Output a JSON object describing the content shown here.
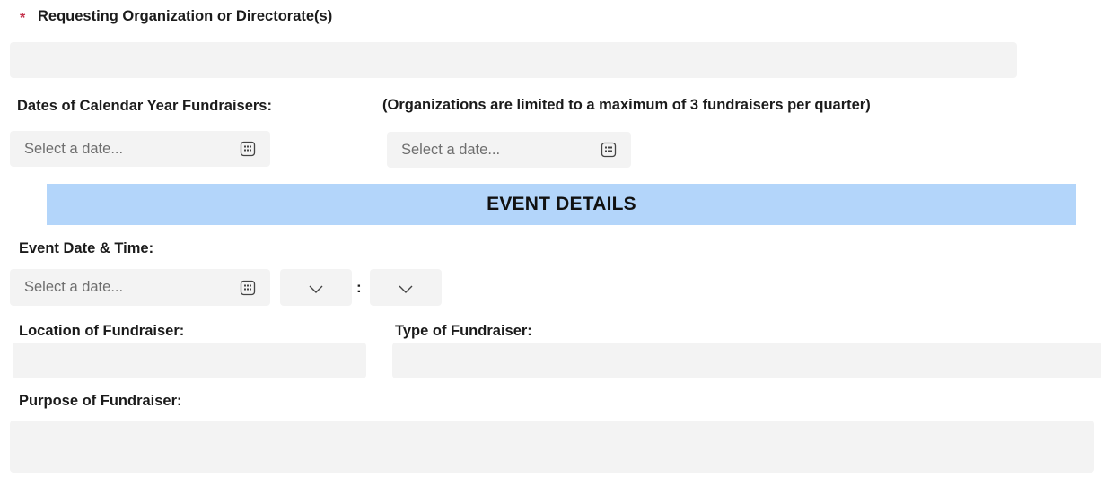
{
  "form": {
    "requesting_org": {
      "required_mark": "*",
      "label": "Requesting Organization or Directorate(s)",
      "value": ""
    },
    "calendar_dates": {
      "label": "Dates of Calendar Year Fundraisers:",
      "note": "(Organizations are limited to a maximum of 3 fundraisers per quarter)",
      "date1_placeholder": "Select a date...",
      "date2_placeholder": "Select a date..."
    },
    "section_title": "EVENT DETAILS",
    "event_datetime": {
      "label": "Event Date & Time:",
      "date_placeholder": "Select a date...",
      "hour_value": "",
      "minute_value": "",
      "separator": ":"
    },
    "location": {
      "label": "Location of Fundraiser:",
      "value": ""
    },
    "type": {
      "label": "Type of Fundraiser:",
      "value": ""
    },
    "purpose": {
      "label": "Purpose of Fundraiser:",
      "value": ""
    }
  },
  "icons": {
    "calendar": "calendar-icon",
    "dropdown": "chevron-down-icon"
  },
  "colors": {
    "field_bg": "#f3f3f3",
    "banner_bg": "#b3d5fa",
    "required": "#c4314b",
    "placeholder": "#6e6e6e"
  }
}
